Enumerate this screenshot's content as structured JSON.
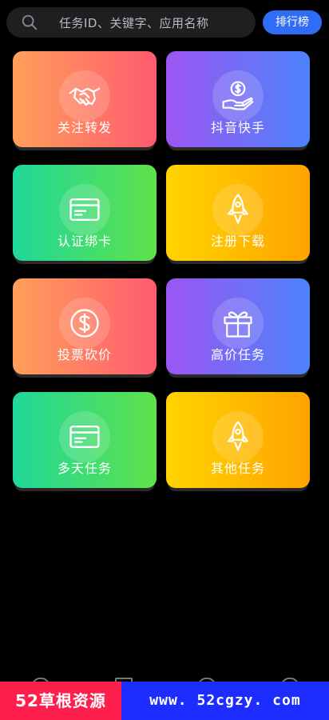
{
  "search": {
    "placeholder": "任务ID、关键字、应用名称",
    "icon": "search-icon"
  },
  "rank_button": {
    "label": "排行榜",
    "color": "#2f6df6"
  },
  "cards": [
    {
      "label": "关注转发",
      "icon": "handshake-icon",
      "theme": "orange"
    },
    {
      "label": "抖音快手",
      "icon": "hand-coin-icon",
      "theme": "purple"
    },
    {
      "label": "认证绑卡",
      "icon": "card-icon",
      "theme": "green"
    },
    {
      "label": "注册下载",
      "icon": "rocket-icon",
      "theme": "yellow"
    },
    {
      "label": "投票砍价",
      "icon": "dollar-icon",
      "theme": "orange"
    },
    {
      "label": "高价任务",
      "icon": "gift-icon",
      "theme": "purple"
    },
    {
      "label": "多天任务",
      "icon": "card-icon",
      "theme": "green"
    },
    {
      "label": "其他任务",
      "icon": "rocket-icon",
      "theme": "yellow"
    }
  ],
  "banner": {
    "left_text": "52草根资源",
    "right_text": "www. 52cgzy. com"
  }
}
